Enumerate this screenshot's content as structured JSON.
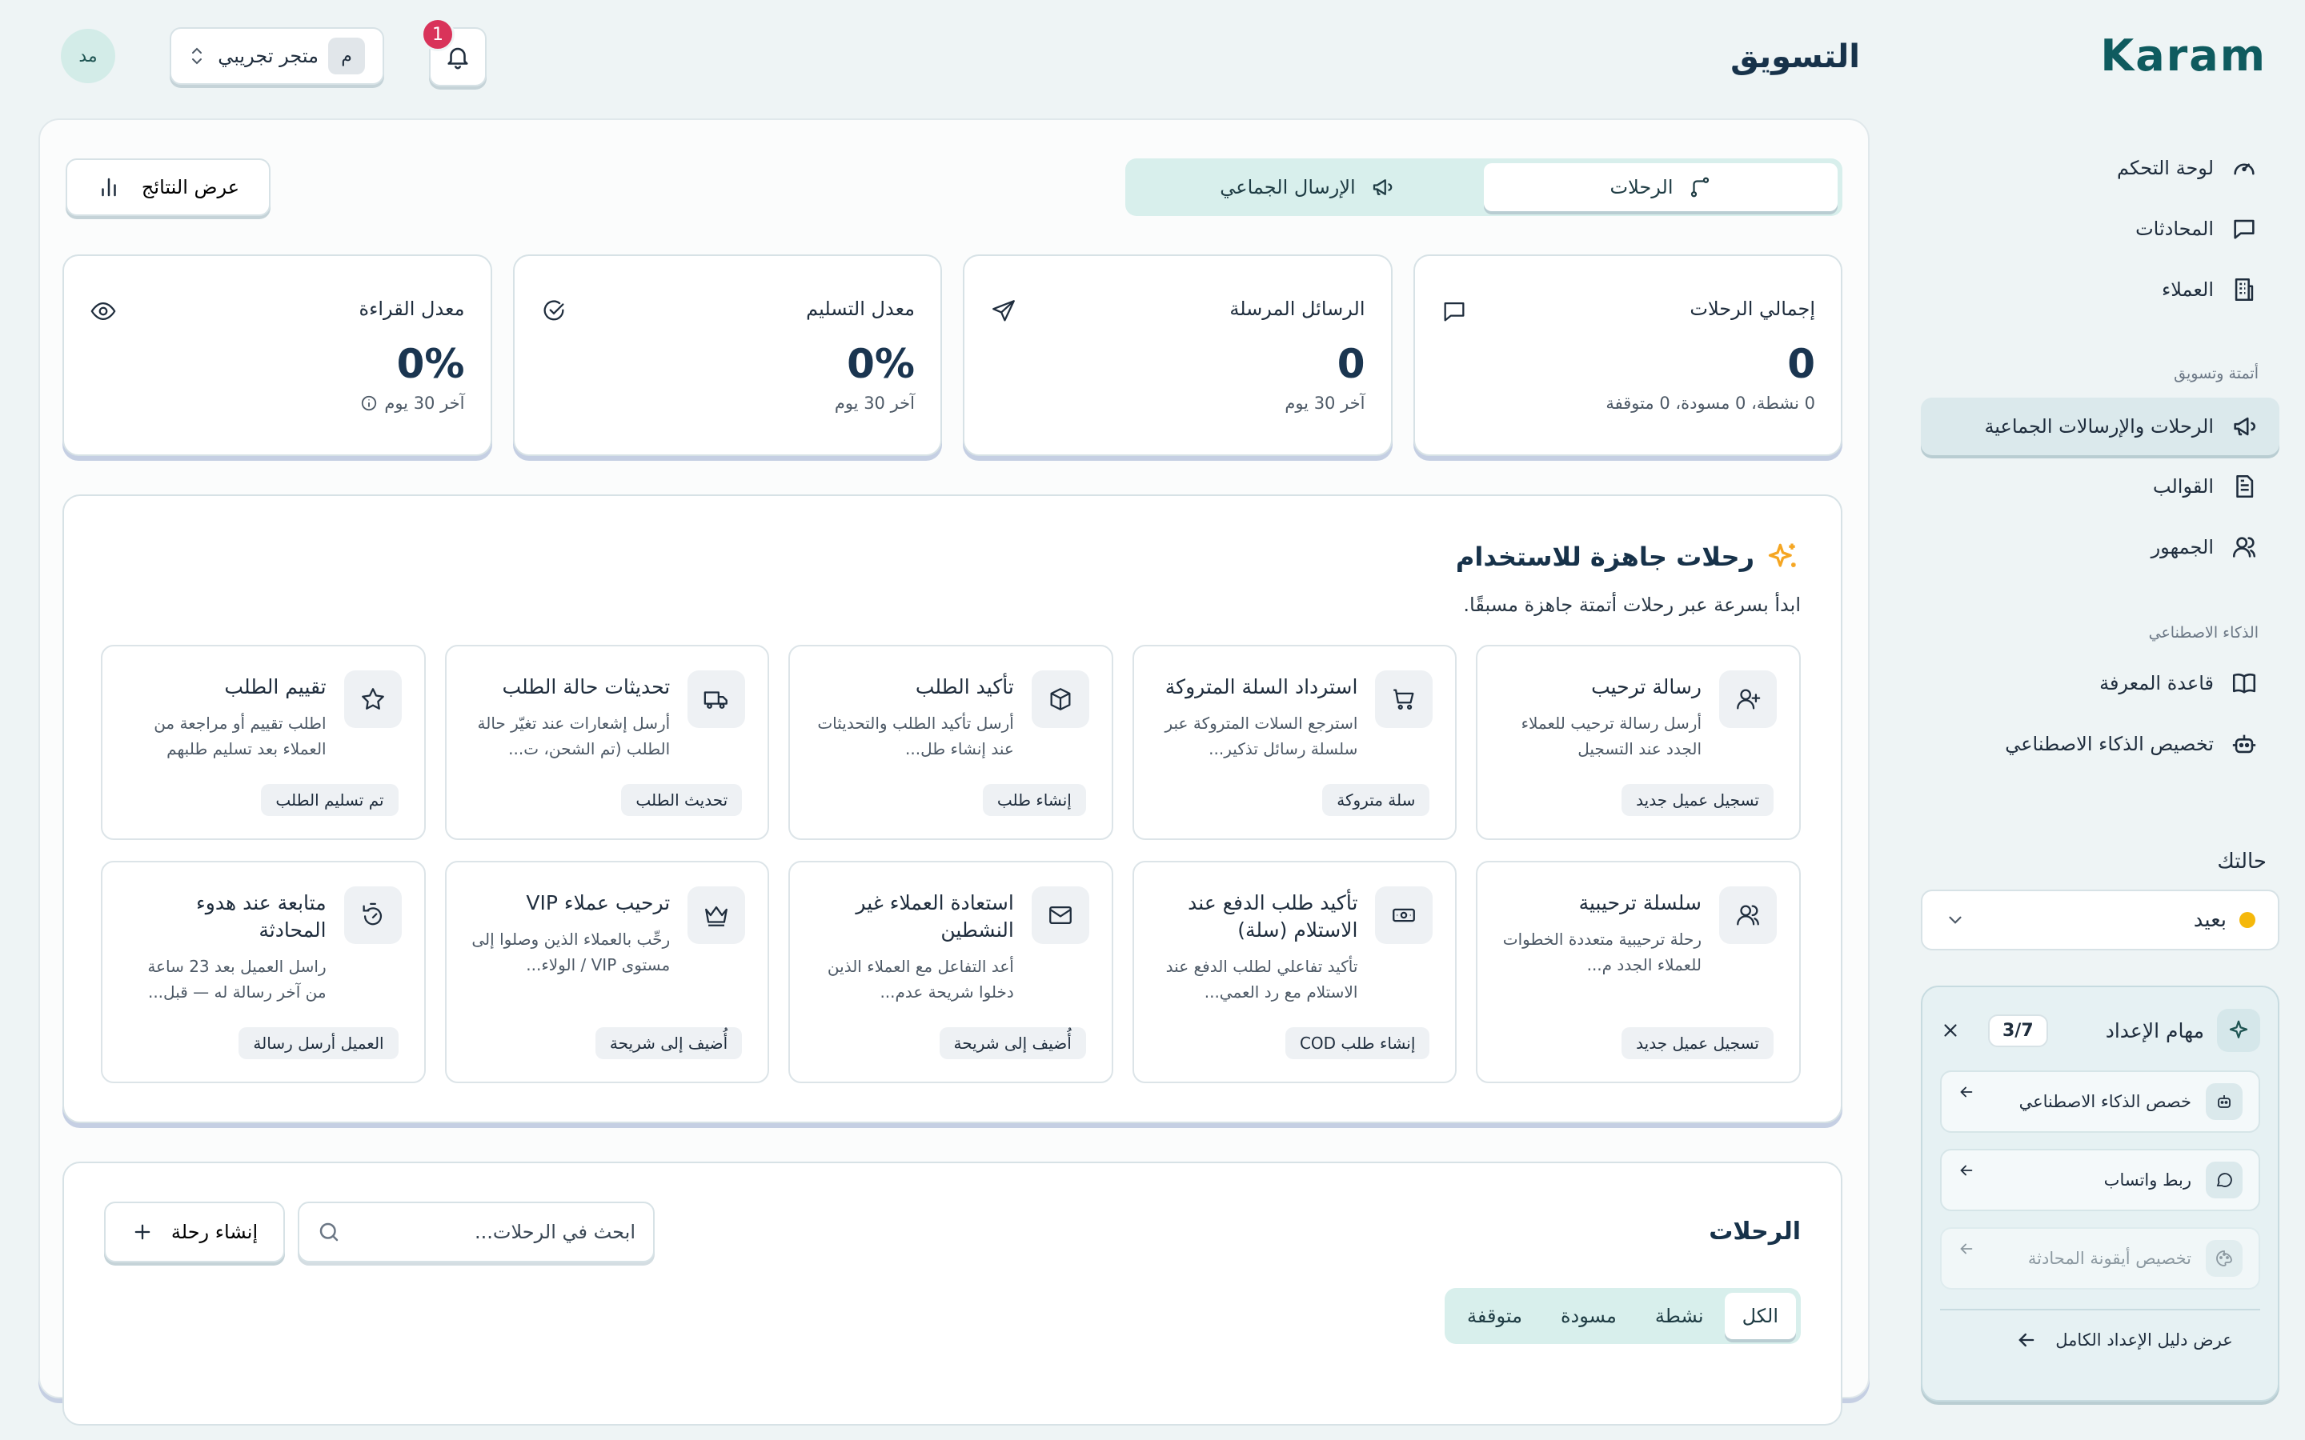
{
  "brand": {
    "logo_text": "Karam"
  },
  "sidebar": {
    "items": [
      {
        "label": "لوحة التحكم"
      },
      {
        "label": "المحادثات"
      },
      {
        "label": "العملاء"
      }
    ],
    "section_marketing": "أتمتة وتسويق",
    "marketing_items": [
      {
        "label": "الرحلات والإرسالات الجماعية"
      },
      {
        "label": "القوالب"
      },
      {
        "label": "الجمهور"
      }
    ],
    "section_ai": "الذكاء الاصطناعي",
    "ai_items": [
      {
        "label": "قاعدة المعرفة"
      },
      {
        "label": "تخصيص الذكاء الاصطناعي"
      }
    ],
    "status_label": "حالتك",
    "status_value": "بعيد",
    "setup": {
      "title": "مهام الإعداد",
      "count": "3/7",
      "tasks": [
        {
          "label": "خصص الذكاء الاصطناعي"
        },
        {
          "label": "ربط واتساب"
        },
        {
          "label": "تخصيص أيقونة المحادثة"
        }
      ],
      "guide_link": "عرض دليل الإعداد الكامل"
    }
  },
  "header": {
    "title": "التسويق",
    "notification_count": "1",
    "store_name": "متجر تجريبي",
    "store_initial": "م",
    "user_initials": "مد"
  },
  "main": {
    "tabs": [
      {
        "label": "الرحلات"
      },
      {
        "label": "الإرسال الجماعي"
      }
    ],
    "results_button": "عرض النتائج",
    "stats": [
      {
        "label": "إجمالي الرحلات",
        "value": "0",
        "sub": "0 نشطة، 0 مسودة، 0 متوقفة"
      },
      {
        "label": "الرسائل المرسلة",
        "value": "0",
        "sub": "آخر 30 يوم"
      },
      {
        "label": "معدل التسليم",
        "value": "0%",
        "sub": "آخر 30 يوم"
      },
      {
        "label": "معدل القراءة",
        "value": "0%",
        "sub": "آخر 30 يوم"
      }
    ],
    "templates": {
      "title": "رحلات جاهزة للاستخدام",
      "subtitle": "ابدأ بسرعة عبر رحلات أتمتة جاهزة مسبقًا.",
      "cards": [
        {
          "title": "رسالة ترحيب",
          "desc": "أرسل رسالة ترحيب للعملاء الجدد عند التسجيل",
          "tag": "تسجيل عميل جديد"
        },
        {
          "title": "استرداد السلة المتروكة",
          "desc": "استرجع السلات المتروكة عبر سلسلة رسائل تذكير...",
          "tag": "سلة متروكة"
        },
        {
          "title": "تأكيد الطلب",
          "desc": "أرسل تأكيد الطلب والتحديثات عند إنشاء طل...",
          "tag": "إنشاء طلب"
        },
        {
          "title": "تحديثات حالة الطلب",
          "desc": "أرسل إشعارات عند تغيّر حالة الطلب (تم الشحن، ت...",
          "tag": "تحديث الطلب"
        },
        {
          "title": "تقييم الطلب",
          "desc": "اطلب تقييم أو مراجعة من العملاء بعد تسليم طلبهم",
          "tag": "تم تسليم الطلب"
        },
        {
          "title": "سلسلة ترحيبية",
          "desc": "رحلة ترحيبية متعددة الخطوات للعملاء الجدد م...",
          "tag": "تسجيل عميل جديد"
        },
        {
          "title": "تأكيد طلب الدفع عند الاستلام (سلة)",
          "desc": "تأكيد تفاعلي لطلب الدفع عند الاستلام مع رد العمي...",
          "tag": "إنشاء طلب COD"
        },
        {
          "title": "استعادة العملاء غير النشطين",
          "desc": "أعد التفاعل مع العملاء الذين دخلوا شريحة عدم...",
          "tag": "أُضيف إلى شريحة"
        },
        {
          "title": "ترحيب عملاء VIP",
          "desc": "رحِّب بالعملاء الذين وصلوا إلى مستوى VIP / الولاء...",
          "tag": "أُضيف إلى شريحة"
        },
        {
          "title": "متابعة عند هدوء المحادثة",
          "desc": "راسل العميل بعد 23 ساعة من آخر رسالة له — قبل...",
          "tag": "العميل أرسل رسالة"
        }
      ]
    },
    "journeys": {
      "title": "الرحلات",
      "search_placeholder": "ابحث في الرحلات...",
      "create_button": "إنشاء رحلة",
      "filters": [
        {
          "label": "الكل"
        },
        {
          "label": "نشطة"
        },
        {
          "label": "مسودة"
        },
        {
          "label": "متوقفة"
        }
      ]
    }
  },
  "colors": {
    "accent": "#0f5b5f",
    "tab_bg": "#d8efec",
    "badge": "#d9335a",
    "status_away": "#f5b80b",
    "sparkle": "#f5a623"
  },
  "icons": {
    "dashboard": "gauge-icon",
    "conversations": "chat-bubble-icon",
    "customers": "building-icon",
    "journeys": "megaphone-icon",
    "templates": "document-icon",
    "audience": "users-icon",
    "knowledge": "book-icon",
    "ai": "robot-icon"
  }
}
